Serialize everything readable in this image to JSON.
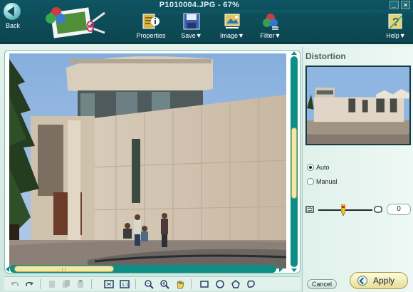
{
  "window": {
    "title": "P1010004.JPG - 67%"
  },
  "toolbar": {
    "back_label": "Back",
    "items": [
      {
        "label": "Properties",
        "icon": "properties-icon"
      },
      {
        "label": "Save▼",
        "icon": "save-disk-icon"
      },
      {
        "label": "Image▼",
        "icon": "image-tools-icon"
      },
      {
        "label": "Filter▼",
        "icon": "filter-icon"
      },
      {
        "label": "Help▼",
        "icon": "help-icon"
      }
    ]
  },
  "panel": {
    "title": "Distortion",
    "mode_options": [
      {
        "label": "Auto",
        "selected": true
      },
      {
        "label": "Manual",
        "selected": false
      }
    ],
    "slider_value": "0",
    "cancel_label": "Cancel",
    "apply_label": "Apply"
  },
  "bottom_tools": [
    "undo-icon",
    "redo-icon",
    "cut-icon",
    "copy-icon",
    "paste-icon",
    "fit-window-icon",
    "actual-size-icon",
    "zoom-out-icon",
    "zoom-in-icon",
    "hand-pan-icon",
    "rectangle-select-icon",
    "ellipse-select-icon",
    "polygon-select-icon",
    "freehand-select-icon"
  ],
  "colors": {
    "accent": "#0d8f86",
    "toolbar": "#0f5461",
    "scroll_thumb": "#f1e9a6"
  }
}
